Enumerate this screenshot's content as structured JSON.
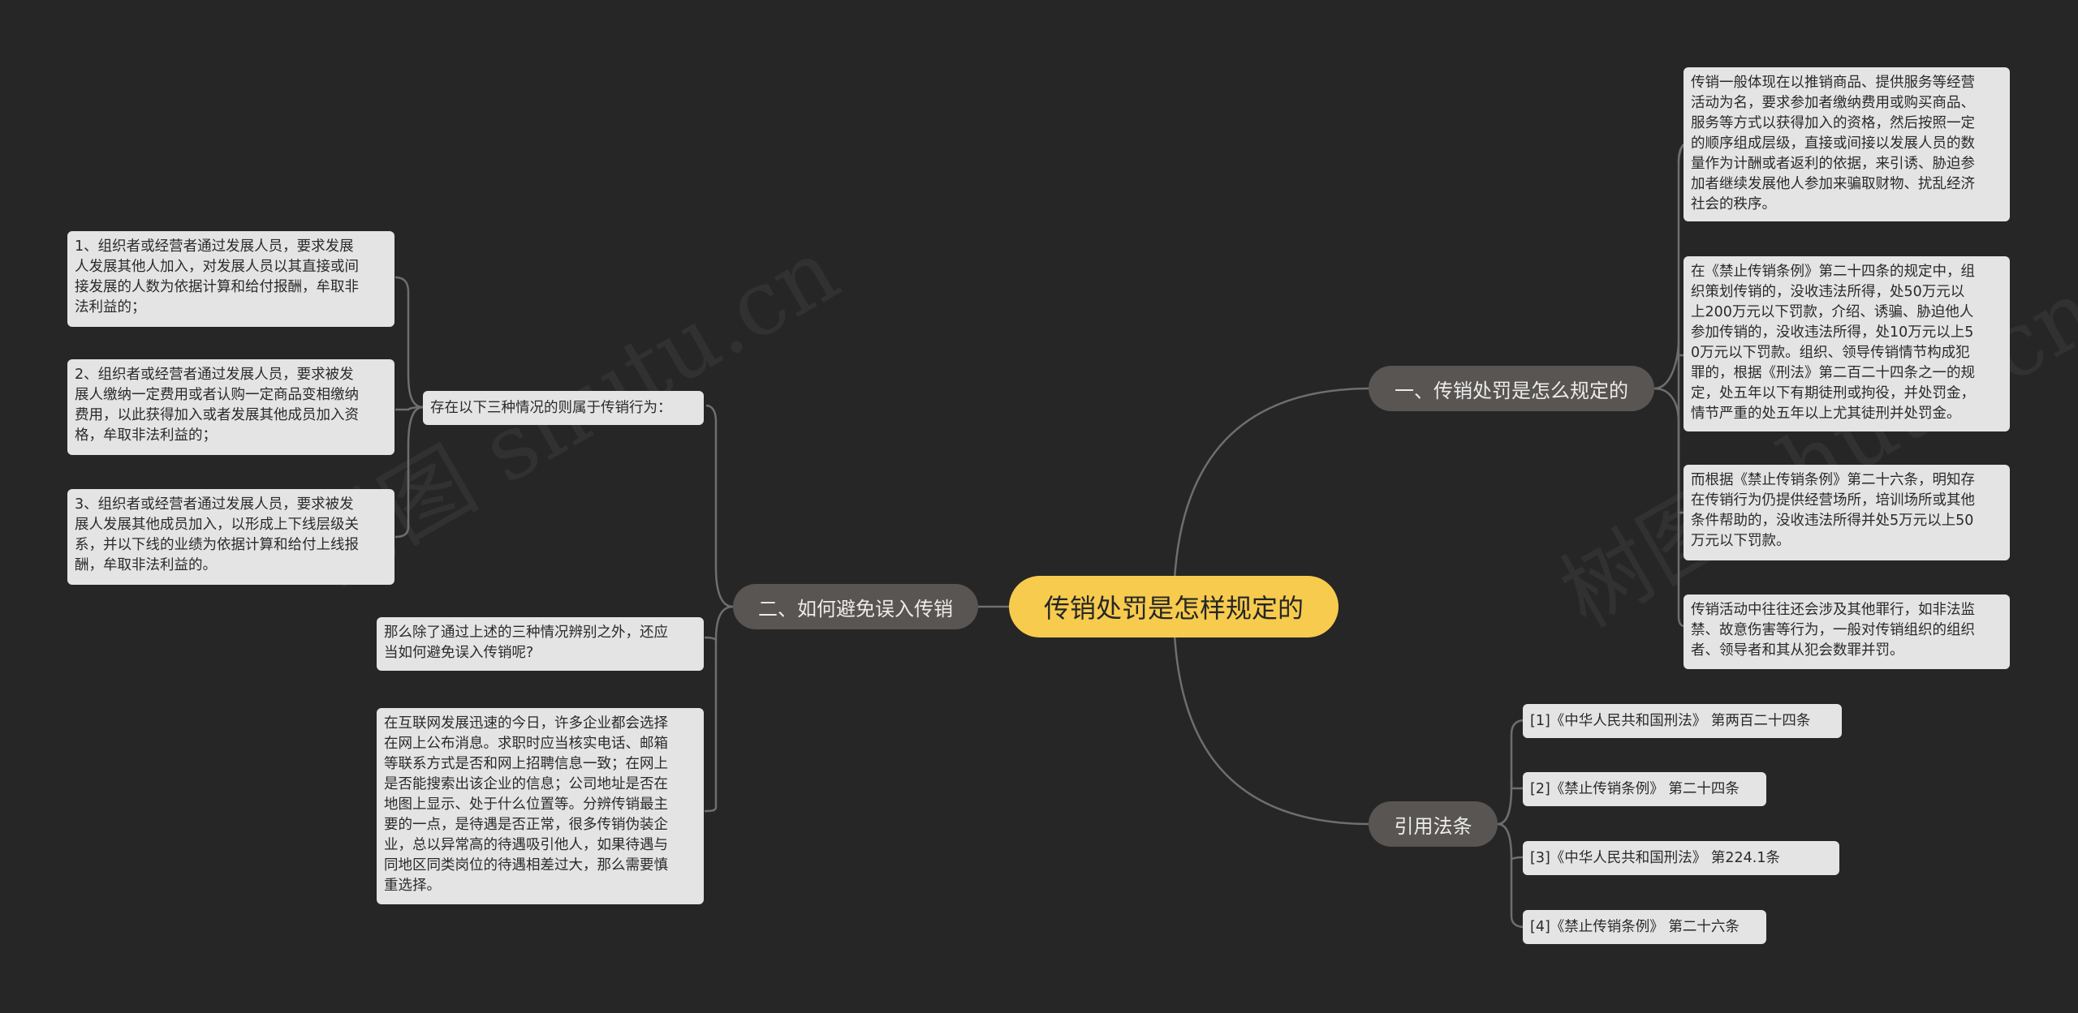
{
  "watermark": "树图 shutu.cn",
  "root": {
    "label": "传销处罚是怎样规定的"
  },
  "branches": {
    "penalty": {
      "label": "一、传销处罚是怎么规定的"
    },
    "avoid": {
      "label": "二、如何避免误入传销"
    },
    "citations": {
      "label": "引用法条"
    }
  },
  "penalty_leaves": [
    "传销一般体现在以推销商品、提供服务等经营\n活动为名，要求参加者缴纳费用或购买商品、\n服务等方式以获得加入的资格，然后按照一定\n的顺序组成层级，直接或间接以发展人员的数\n量作为计酬或者返利的依据，来引诱、胁迫参\n加者继续发展他人参加来骗取财物、扰乱经济\n社会的秩序。",
    "在《禁止传销条例》第二十四条的规定中，组\n织策划传销的，没收违法所得，处50万元以\n上200万元以下罚款，介绍、诱骗、胁迫他人\n参加传销的，没收违法所得，处10万元以上5\n0万元以下罚款。组织、领导传销情节构成犯\n罪的，根据《刑法》第二百二十四条之一的规\n定，处五年以下有期徒刑或拘役，并处罚金，\n情节严重的处五年以上尤其徒刑并处罚金。",
    "而根据《禁止传销条例》第二十六条，明知存\n在传销行为仍提供经营场所，培训场所或其他\n条件帮助的，没收违法所得并处5万元以上50\n万元以下罚款。",
    "传销活动中往往还会涉及其他罪行，如非法监\n禁、故意伤害等行为，一般对传销组织的组织\n者、领导者和其从犯会数罪并罚。"
  ],
  "avoid_leaves": {
    "situations_title": "存在以下三种情况的则属于传销行为：",
    "situations": [
      "1、组织者或经营者通过发展人员，要求发展\n人发展其他人加入，对发展人员以其直接或间\n接发展的人数为依据计算和给付报酬，牟取非\n法利益的；",
      "2、组织者或经营者通过发展人员，要求被发\n展人缴纳一定费用或者认购一定商品变相缴纳\n费用，以此获得加入或者发展其他成员加入资\n格，牟取非法利益的；",
      "3、组织者或经营者通过发展人员，要求被发\n展人发展其他成员加入，以形成上下线层级关\n系，并以下线的业绩为依据计算和给付上线报\n酬，牟取非法利益的。"
    ],
    "question": "那么除了通过上述的三种情况辨别之外，还应\n当如何避免误入传销呢?",
    "advice": "在互联网发展迅速的今日，许多企业都会选择\n在网上公布消息。求职时应当核实电话、邮箱\n等联系方式是否和网上招聘信息一致；在网上\n是否能搜索出该企业的信息；公司地址是否在\n地图上显示、处于什么位置等。分辨传销最主\n要的一点，是待遇是否正常，很多传销伪装企\n业，总以异常高的待遇吸引他人，如果待遇与\n同地区同类岗位的待遇相差过大，那么需要慎\n重选择。"
  },
  "citation_leaves": [
    "[1]《中华人民共和国刑法》 第两百二十四条",
    "[2]《禁止传销条例》 第二十四条",
    "[3]《中华人民共和国刑法》 第224.1条",
    "[4]《禁止传销条例》 第二十六条"
  ]
}
